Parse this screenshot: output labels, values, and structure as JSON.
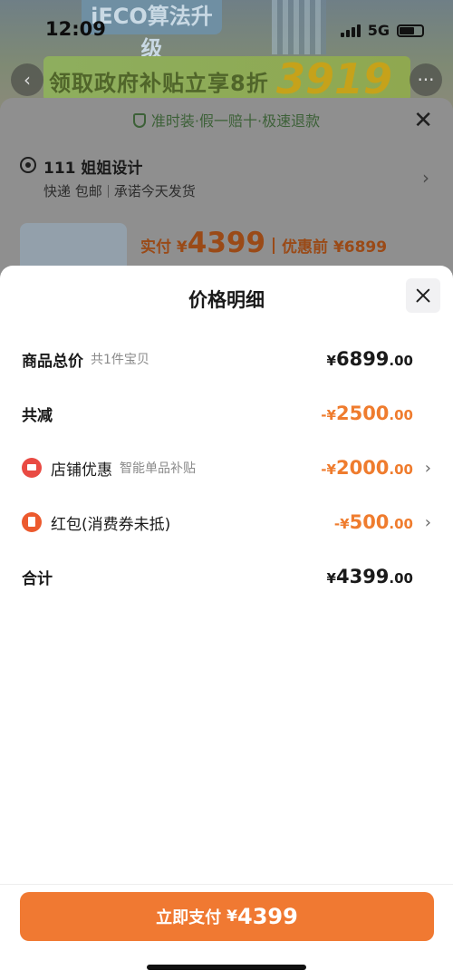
{
  "status_bar": {
    "time": "12:09",
    "network": "5G"
  },
  "background": {
    "banner_tag": "iECO算法升级",
    "promo_text": "领取政府补贴立享8折",
    "promo_price": "3919",
    "guarantee": "准时装·假一赔十·极速退款",
    "address": {
      "name": "111 姐姐设计",
      "delivery": "快递 包邮",
      "promise": "承诺今天发货"
    },
    "pay_label": "实付 ¥",
    "pay_amount": "4399",
    "before_discount": "优惠前 ¥6899"
  },
  "sheet": {
    "title": "价格明细",
    "rows": [
      {
        "label": "商品总价",
        "sub": "共1件宝贝",
        "currency": "¥",
        "int": "6899",
        "dec": ".00"
      },
      {
        "label": "共减",
        "currency": "-¥",
        "int": "2500",
        "dec": ".00"
      },
      {
        "label": "店铺优惠",
        "sub": "智能单品补贴",
        "currency": "-¥",
        "int": "2000",
        "dec": ".00",
        "icon": "store-coupon-icon"
      },
      {
        "label": "红包(消费券未抵)",
        "currency": "-¥",
        "int": "500",
        "dec": ".00",
        "icon": "red-packet-icon"
      },
      {
        "label": "合计",
        "currency": "¥",
        "int": "4399",
        "dec": ".00"
      }
    ]
  },
  "pay_button": {
    "text": "立即支付",
    "currency": "¥",
    "amount": "4399"
  },
  "colors": {
    "accent": "#f07932",
    "discount": "#ef7c2e"
  }
}
